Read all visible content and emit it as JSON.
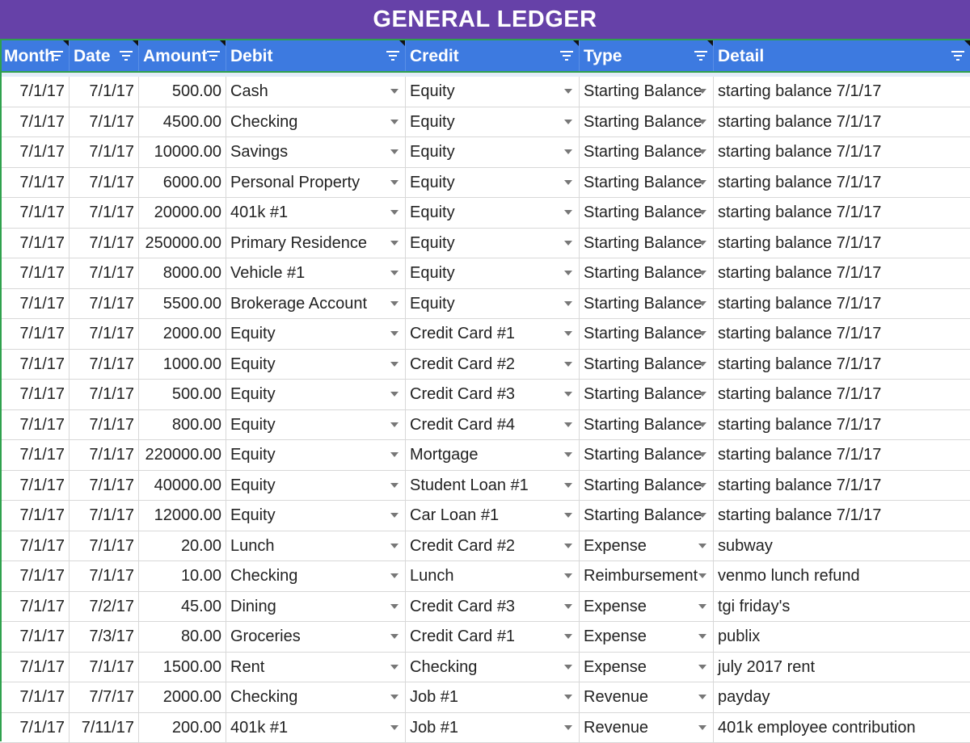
{
  "title": "GENERAL LEDGER",
  "columns": [
    "Month",
    "Date",
    "Amount",
    "Debit",
    "Credit",
    "Type",
    "Detail"
  ],
  "rows": [
    [
      "7/1/17",
      "7/1/17",
      "500.00",
      "Cash",
      "Equity",
      "Starting Balance",
      "starting balance 7/1/17"
    ],
    [
      "7/1/17",
      "7/1/17",
      "4500.00",
      "Checking",
      "Equity",
      "Starting Balance",
      "starting balance 7/1/17"
    ],
    [
      "7/1/17",
      "7/1/17",
      "10000.00",
      "Savings",
      "Equity",
      "Starting Balance",
      "starting balance 7/1/17"
    ],
    [
      "7/1/17",
      "7/1/17",
      "6000.00",
      "Personal Property",
      "Equity",
      "Starting Balance",
      "starting balance 7/1/17"
    ],
    [
      "7/1/17",
      "7/1/17",
      "20000.00",
      "401k #1",
      "Equity",
      "Starting Balance",
      "starting balance 7/1/17"
    ],
    [
      "7/1/17",
      "7/1/17",
      "250000.00",
      "Primary Residence",
      "Equity",
      "Starting Balance",
      "starting balance 7/1/17"
    ],
    [
      "7/1/17",
      "7/1/17",
      "8000.00",
      "Vehicle #1",
      "Equity",
      "Starting Balance",
      "starting balance 7/1/17"
    ],
    [
      "7/1/17",
      "7/1/17",
      "5500.00",
      "Brokerage Account",
      "Equity",
      "Starting Balance",
      "starting balance 7/1/17"
    ],
    [
      "7/1/17",
      "7/1/17",
      "2000.00",
      "Equity",
      "Credit Card #1",
      "Starting Balance",
      "starting balance 7/1/17"
    ],
    [
      "7/1/17",
      "7/1/17",
      "1000.00",
      "Equity",
      "Credit Card #2",
      "Starting Balance",
      "starting balance 7/1/17"
    ],
    [
      "7/1/17",
      "7/1/17",
      "500.00",
      "Equity",
      "Credit Card #3",
      "Starting Balance",
      "starting balance 7/1/17"
    ],
    [
      "7/1/17",
      "7/1/17",
      "800.00",
      "Equity",
      "Credit Card #4",
      "Starting Balance",
      "starting balance 7/1/17"
    ],
    [
      "7/1/17",
      "7/1/17",
      "220000.00",
      "Equity",
      "Mortgage",
      "Starting Balance",
      "starting balance 7/1/17"
    ],
    [
      "7/1/17",
      "7/1/17",
      "40000.00",
      "Equity",
      "Student Loan #1",
      "Starting Balance",
      "starting balance 7/1/17"
    ],
    [
      "7/1/17",
      "7/1/17",
      "12000.00",
      "Equity",
      "Car Loan #1",
      "Starting Balance",
      "starting balance 7/1/17"
    ],
    [
      "7/1/17",
      "7/1/17",
      "20.00",
      "Lunch",
      "Credit Card #2",
      "Expense",
      "subway"
    ],
    [
      "7/1/17",
      "7/1/17",
      "10.00",
      "Checking",
      "Lunch",
      "Reimbursement",
      "venmo lunch refund"
    ],
    [
      "7/1/17",
      "7/2/17",
      "45.00",
      "Dining",
      "Credit Card #3",
      "Expense",
      "tgi friday's"
    ],
    [
      "7/1/17",
      "7/3/17",
      "80.00",
      "Groceries",
      "Credit Card #1",
      "Expense",
      "publix"
    ],
    [
      "7/1/17",
      "7/1/17",
      "1500.00",
      "Rent",
      "Checking",
      "Expense",
      "july 2017 rent"
    ],
    [
      "7/1/17",
      "7/7/17",
      "2000.00",
      "Checking",
      "Job #1",
      "Revenue",
      "payday"
    ],
    [
      "7/1/17",
      "7/11/17",
      "200.00",
      "401k #1",
      "Job #1",
      "Revenue",
      "401k employee contribution"
    ]
  ],
  "colors": {
    "title_bg": "#6641a8",
    "header_bg": "#3d7ae0",
    "border_accent": "#2fa14d"
  },
  "icons": {
    "column_filter": "filter-icon",
    "cell_dropdown": "dropdown-arrow-icon"
  }
}
